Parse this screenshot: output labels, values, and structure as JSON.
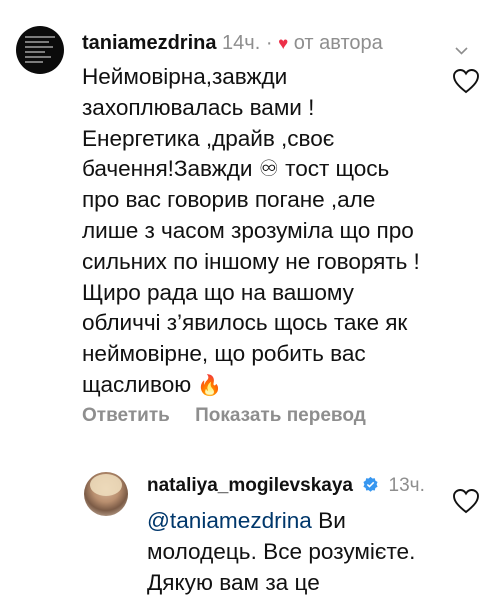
{
  "comment": {
    "username": "taniamezdrina",
    "time": "14ч.",
    "separator": "·",
    "author_label": "от автора",
    "text_part1": "Неймовірна,завжди захоплювалась вами ! Енергетика ,драйв ,своє бачення!Завжди",
    "infinity": "♾",
    "text_part2": "тост щось про вас говорив погане ,але лише з часом зрозуміла що про сильних по іншому не говорять !Щиро рада що на вашому обличчі з’явилось щось таке як неймовірне, що робить вас щасливою",
    "emoji": "🔥",
    "reply_action": "Ответить",
    "translate_action": "Показать перевод"
  },
  "reply": {
    "username": "nataliya_mogilevskaya",
    "time": "13ч.",
    "mention": "@taniamezdrina",
    "text": "Ви молодець. Все розумієте. Дякую вам за це"
  },
  "icons": {
    "heart_color": "#ed2f48",
    "verified_color": "#3897f0",
    "mention_color": "#00376b"
  }
}
